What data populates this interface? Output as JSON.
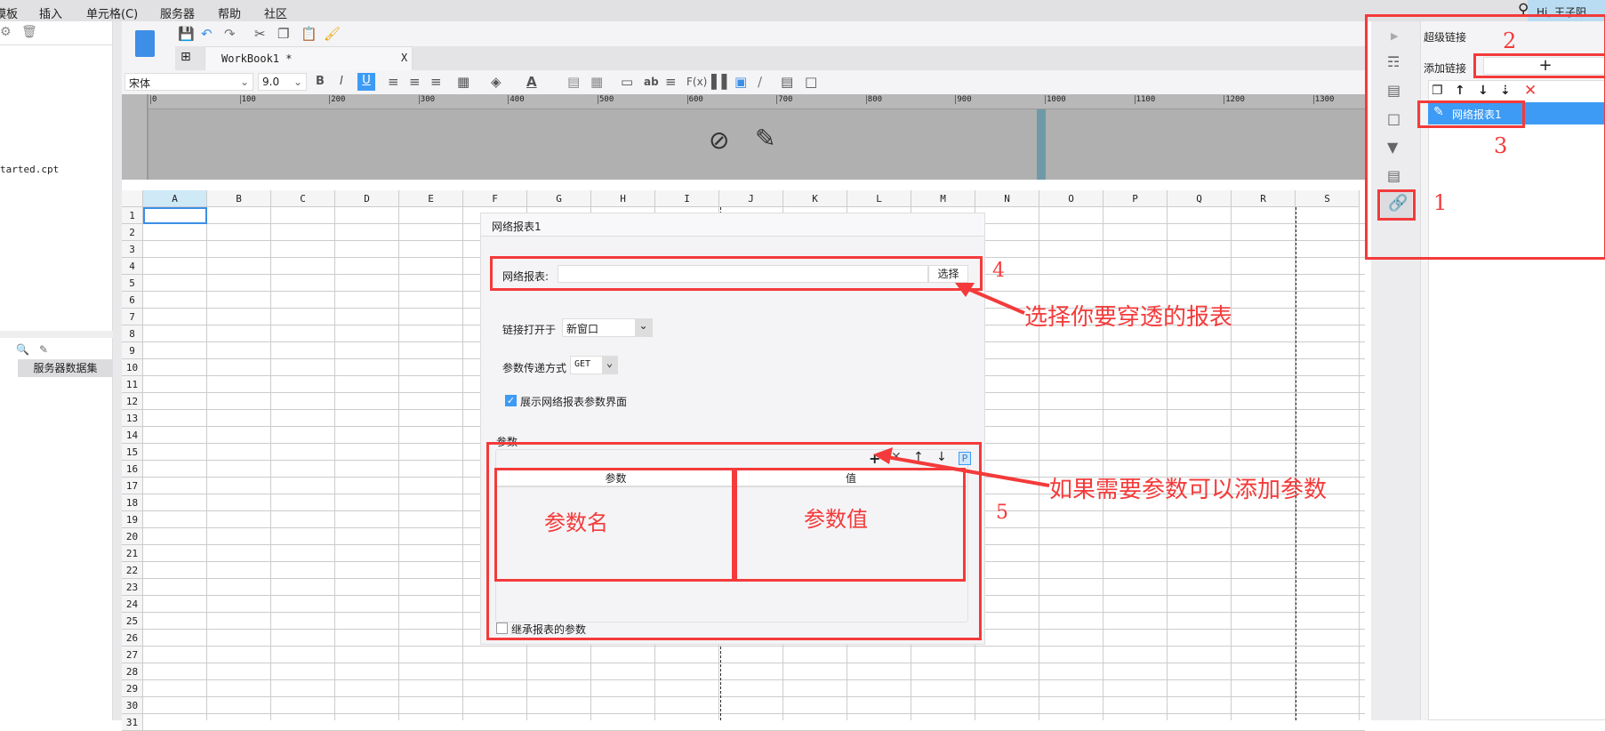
{
  "menu": [
    "模板",
    "插入",
    "单元格(C)",
    "服务器",
    "帮助",
    "社区"
  ],
  "user": "Hi, 王子阳",
  "left": {
    "file": "tarted.cpt",
    "tab": "服务器数据集"
  },
  "tab": {
    "title": "WorkBook1 *",
    "close": "X"
  },
  "format": {
    "font": "宋体",
    "size": "9.0",
    "bold": "B",
    "italic": "I",
    "underline": "U"
  },
  "ruler": [
    "0",
    "100",
    "200",
    "300",
    "400",
    "500",
    "600",
    "700",
    "800",
    "900",
    "1000",
    "1100",
    "1200",
    "1300"
  ],
  "columns": [
    "A",
    "B",
    "C",
    "D",
    "E",
    "F",
    "G",
    "H",
    "I",
    "J",
    "K",
    "L",
    "M",
    "N",
    "O",
    "P",
    "Q",
    "R",
    "S"
  ],
  "rows": [
    "1",
    "2",
    "3",
    "4",
    "5",
    "6",
    "7",
    "8",
    "9",
    "10",
    "11",
    "12",
    "13",
    "14",
    "15",
    "16",
    "17",
    "18",
    "19",
    "20",
    "21",
    "22",
    "23",
    "24",
    "25",
    "26",
    "27",
    "28",
    "29",
    "30",
    "31"
  ],
  "dialog": {
    "title": "网络报表1",
    "report_label": "网络报表:",
    "report_value": "",
    "choose": "选择",
    "open_label": "链接打开于",
    "open_value": "新窗口",
    "method_label": "参数传递方式",
    "method_value": "GET",
    "show_params": "展示网络报表参数界面",
    "params_label": "参数",
    "col_param": "参数",
    "col_value": "值",
    "inherit": "继承报表的参数",
    "p_icon": "P"
  },
  "panel": {
    "title": "超级链接",
    "add_label": "添加链接",
    "add_btn": "+",
    "items": [
      "网络报表1"
    ]
  },
  "annotations": {
    "n1": "1",
    "n2": "2",
    "n3": "3",
    "n4": "4",
    "n5": "5",
    "choose_tip": "选择你要穿透的报表",
    "param_tip": "如果需要参数可以添加参数",
    "param_name": "参数名",
    "param_value": "参数值"
  },
  "colors": {
    "accent": "#3d9bf5",
    "annotation": "#f43a3a"
  }
}
